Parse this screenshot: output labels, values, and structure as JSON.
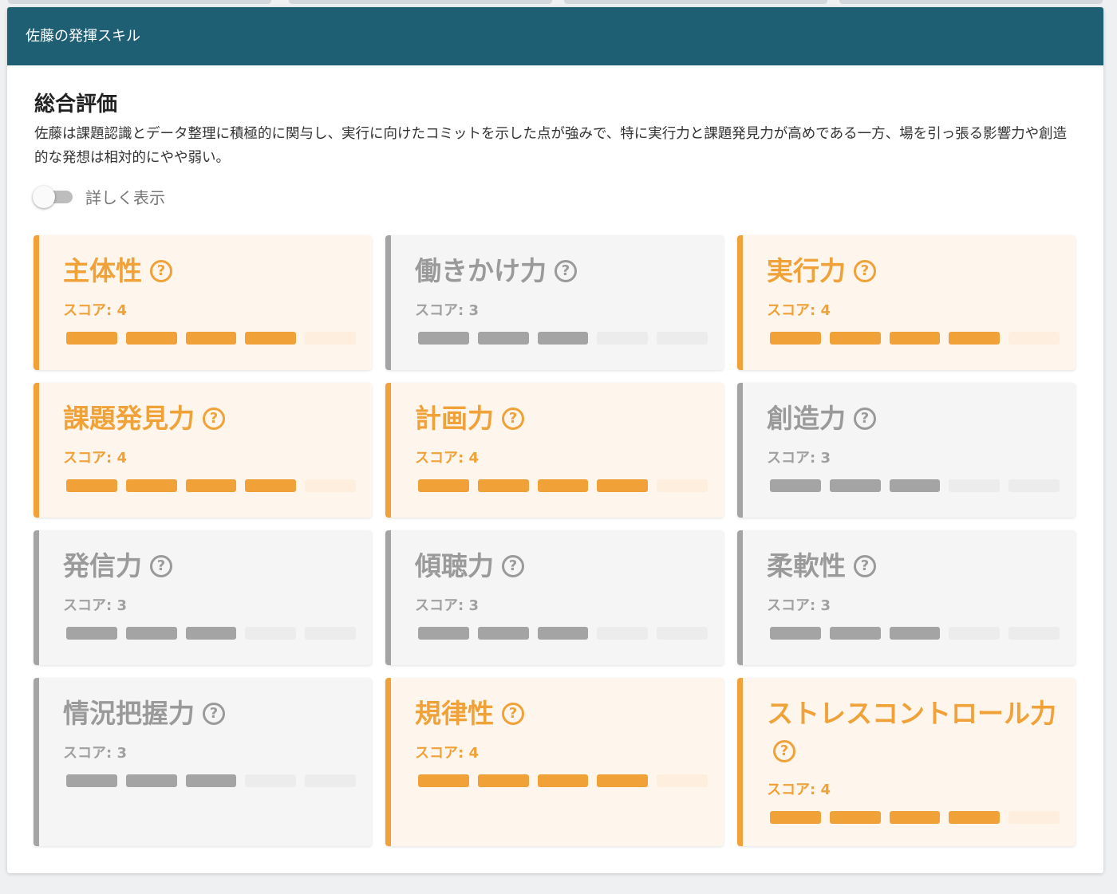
{
  "panel": {
    "title": "佐藤の発揮スキル"
  },
  "summary": {
    "title": "総合評価",
    "text": "佐藤は課題認識とデータ整理に積極的に関与し、実行に向けたコミットを示した点が強みで、特に実行力と課題発見力が高めである一方、場を引っ張る影響力や創造的な発想は相対的にやや弱い。"
  },
  "toggle": {
    "label": "詳しく表示",
    "checked": false
  },
  "help_glyph": "?",
  "score_max": 5,
  "colors": {
    "header": "#1f5f73",
    "accent": "#f0a138",
    "muted": "#a4a4a4"
  },
  "skills": [
    {
      "name": "主体性",
      "score_label": "スコア: 4",
      "score": 4,
      "highlight": true
    },
    {
      "name": "働きかけ力",
      "score_label": "スコア: 3",
      "score": 3,
      "highlight": false
    },
    {
      "name": "実行力",
      "score_label": "スコア: 4",
      "score": 4,
      "highlight": true
    },
    {
      "name": "課題発見力",
      "score_label": "スコア: 4",
      "score": 4,
      "highlight": true
    },
    {
      "name": "計画力",
      "score_label": "スコア: 4",
      "score": 4,
      "highlight": true
    },
    {
      "name": "創造力",
      "score_label": "スコア: 3",
      "score": 3,
      "highlight": false
    },
    {
      "name": "発信力",
      "score_label": "スコア: 3",
      "score": 3,
      "highlight": false
    },
    {
      "name": "傾聴力",
      "score_label": "スコア: 3",
      "score": 3,
      "highlight": false
    },
    {
      "name": "柔軟性",
      "score_label": "スコア: 3",
      "score": 3,
      "highlight": false
    },
    {
      "name": "情況把握力",
      "score_label": "スコア: 3",
      "score": 3,
      "highlight": false
    },
    {
      "name": "規律性",
      "score_label": "スコア: 4",
      "score": 4,
      "highlight": true
    },
    {
      "name": "ストレスコントロール力",
      "score_label": "スコア: 4",
      "score": 4,
      "highlight": true
    }
  ]
}
